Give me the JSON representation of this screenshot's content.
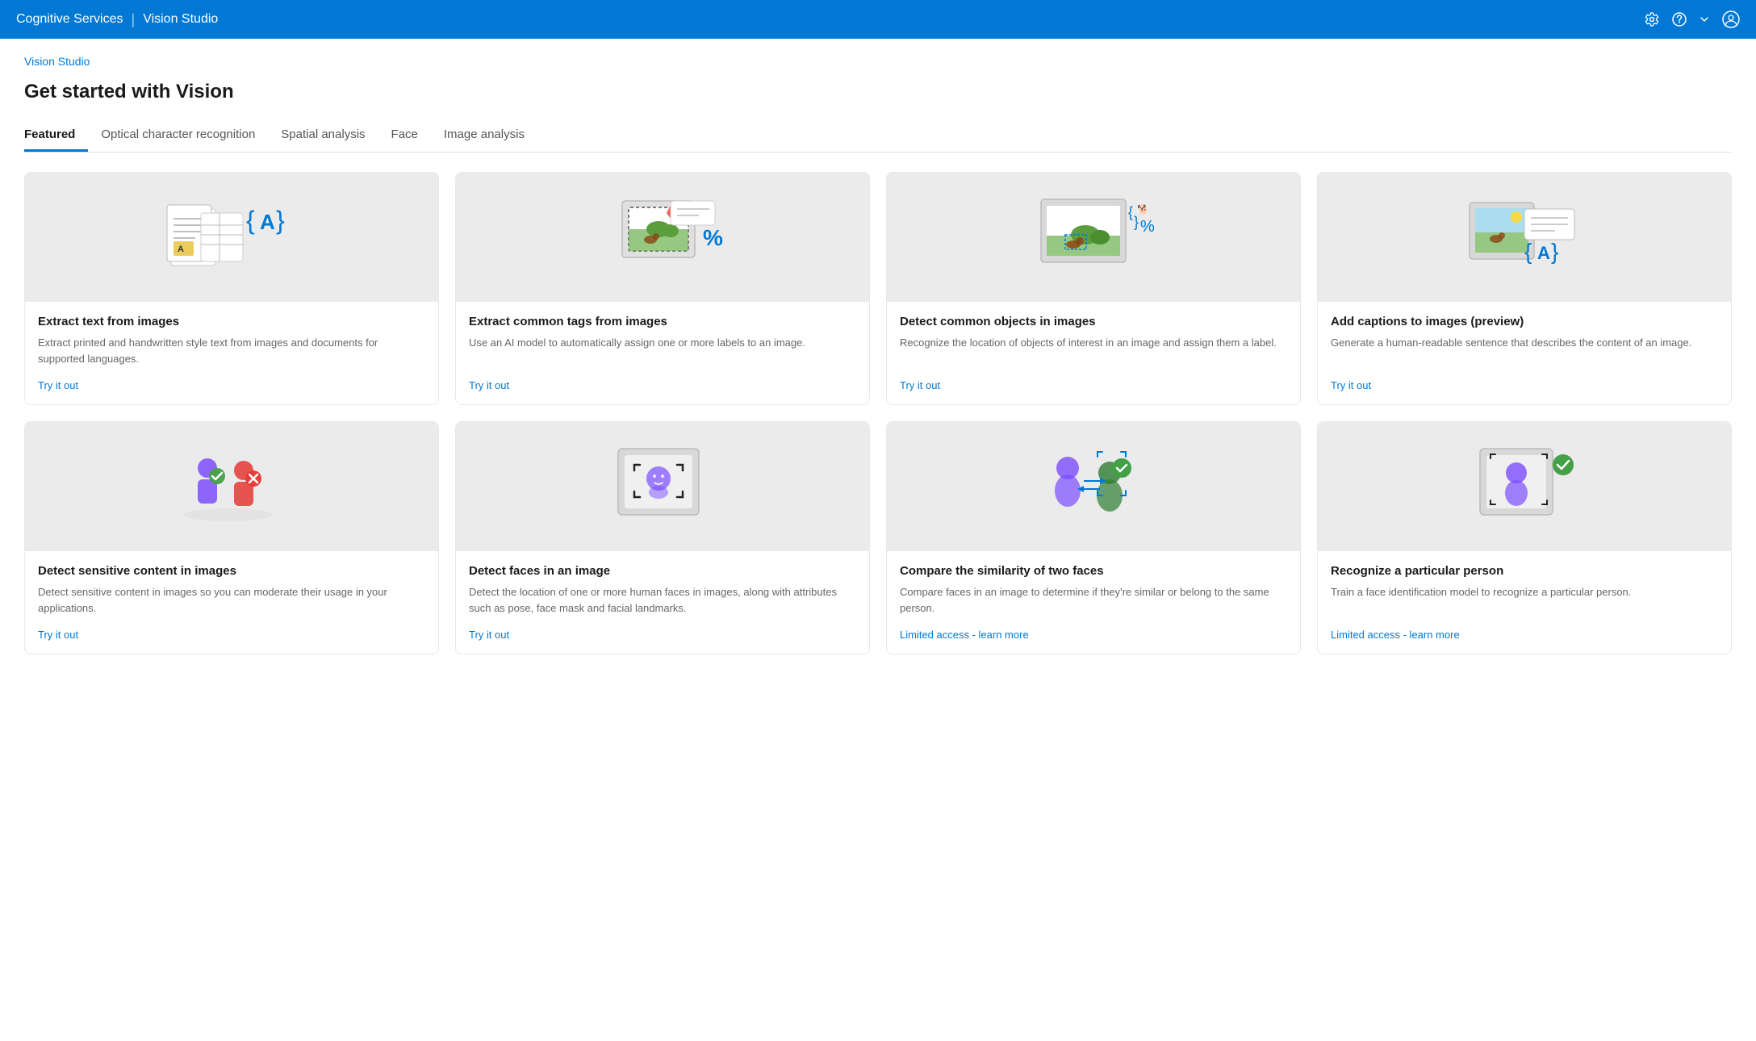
{
  "header": {
    "brand": "Cognitive Services",
    "divider": "|",
    "app": "Vision Studio",
    "icons": [
      "gear-icon",
      "question-icon",
      "chevron-down-icon",
      "user-icon"
    ]
  },
  "breadcrumb": "Vision Studio",
  "page_title": "Get started with Vision",
  "tabs": [
    {
      "label": "Featured",
      "active": true
    },
    {
      "label": "Optical character recognition",
      "active": false
    },
    {
      "label": "Spatial analysis",
      "active": false
    },
    {
      "label": "Face",
      "active": false
    },
    {
      "label": "Image analysis",
      "active": false
    }
  ],
  "cards_row1": [
    {
      "id": "extract-text",
      "title": "Extract text from images",
      "desc": "Extract printed and handwritten style text from images and documents for supported languages.",
      "link": "Try it out"
    },
    {
      "id": "extract-tags",
      "title": "Extract common tags from images",
      "desc": "Use an AI model to automatically assign one or more labels to an image.",
      "link": "Try it out"
    },
    {
      "id": "detect-objects",
      "title": "Detect common objects in images",
      "desc": "Recognize the location of objects of interest in an image and assign them a label.",
      "link": "Try it out"
    },
    {
      "id": "add-captions",
      "title": "Add captions to images (preview)",
      "desc": "Generate a human-readable sentence that describes the content of an image.",
      "link": "Try it out"
    }
  ],
  "cards_row2": [
    {
      "id": "detect-sensitive",
      "title": "Detect sensitive content in images",
      "desc": "Detect sensitive content in images so you can moderate their usage in your applications.",
      "link": "Try it out"
    },
    {
      "id": "detect-faces",
      "title": "Detect faces in an image",
      "desc": "Detect the location of one or more human faces in images, along with attributes such as pose, face mask and facial landmarks.",
      "link": "Try it out"
    },
    {
      "id": "compare-faces",
      "title": "Compare the similarity of two faces",
      "desc": "Compare faces in an image to determine if they're similar or belong to the same person.",
      "link": "Limited access - learn more"
    },
    {
      "id": "recognize-person",
      "title": "Recognize a particular person",
      "desc": "Train a face identification model to recognize a particular person.",
      "link": "Limited access - learn more"
    }
  ]
}
